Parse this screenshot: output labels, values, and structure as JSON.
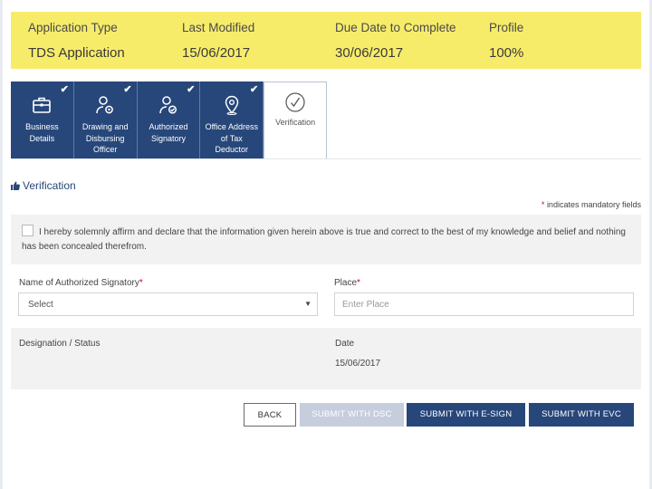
{
  "summary": {
    "application_type_label": "Application Type",
    "application_type_value": "TDS Application",
    "last_modified_label": "Last Modified",
    "last_modified_value": "15/06/2017",
    "due_date_label": "Due Date to Complete",
    "due_date_value": "30/06/2017",
    "profile_label": "Profile",
    "profile_value": "100%"
  },
  "steps": [
    {
      "label": "Business Details",
      "icon": "briefcase-icon",
      "completed": true
    },
    {
      "label": "Drawing and Disbursing Officer",
      "icon": "user-gear-icon",
      "completed": true
    },
    {
      "label": "Authorized Signatory",
      "icon": "user-check-icon",
      "completed": true
    },
    {
      "label": "Office Address of Tax Deductor",
      "icon": "location-pin-icon",
      "completed": true
    },
    {
      "label": "Verification",
      "icon": "check-circle-icon",
      "completed": false,
      "active": true
    }
  ],
  "section": {
    "title": "Verification",
    "icon": "thumbs-up-icon",
    "mandatory_note": "indicates mandatory fields"
  },
  "declaration": {
    "text": "I hereby solemnly affirm and declare that the information given herein above is true and correct to the best of my knowledge and belief and nothing has been concealed therefrom.",
    "checked": false
  },
  "form": {
    "signatory_label": "Name of Authorized Signatory",
    "signatory_value": "Select",
    "place_label": "Place",
    "place_placeholder": "Enter Place",
    "designation_label": "Designation / Status",
    "date_label": "Date",
    "date_value": "15/06/2017"
  },
  "buttons": {
    "back": "BACK",
    "submit_dsc": "SUBMIT WITH DSC",
    "submit_esign": "SUBMIT WITH E-SIGN",
    "submit_evc": "SUBMIT WITH EVC"
  },
  "colors": {
    "summary_bg": "#f7ec6a",
    "primary": "#27477a",
    "disabled": "#c6cedd",
    "required": "#d0021b"
  }
}
